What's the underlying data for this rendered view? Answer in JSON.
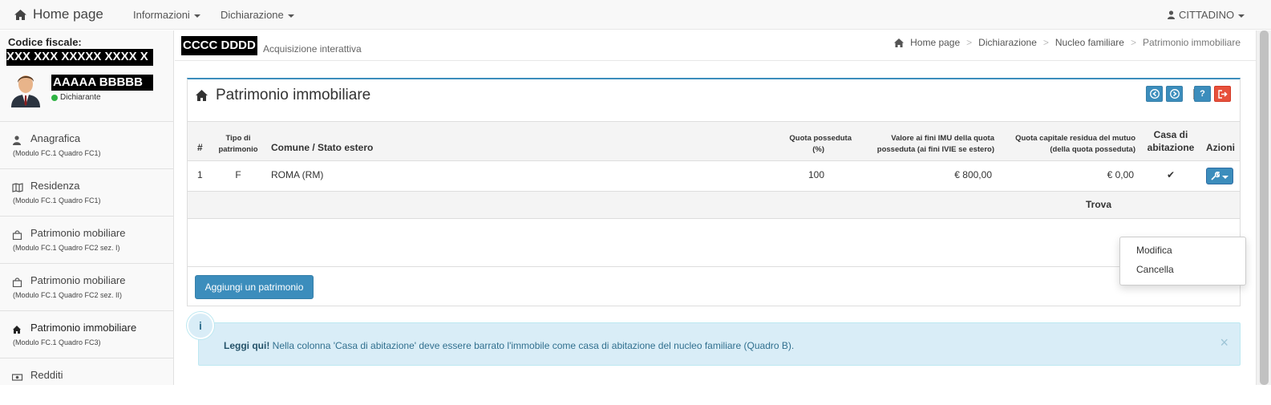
{
  "navbar": {
    "brand": "Home page",
    "menu_informazioni": "Informazioni",
    "menu_dichiarazione": "Dichiarazione",
    "user_menu": "CITTADINO"
  },
  "sidebar": {
    "cf_label": "Codice fiscale:",
    "cf_value": "XXX XXX XXXXX XXXX X",
    "user_name": "AAAAA BBBBB",
    "user_role": "Dichiarante",
    "items": [
      {
        "label": "Anagrafica",
        "sub": "(Modulo FC.1 Quadro FC1)",
        "icon": "user-icon"
      },
      {
        "label": "Residenza",
        "sub": "(Modulo FC.1 Quadro FC1)",
        "icon": "map-icon"
      },
      {
        "label": "Patrimonio mobiliare",
        "sub": "(Modulo FC.1 Quadro FC2 sez. I)",
        "icon": "bag-icon"
      },
      {
        "label": "Patrimonio mobiliare",
        "sub": "(Modulo FC.1 Quadro FC2 sez. II)",
        "icon": "bag-icon"
      },
      {
        "label": "Patrimonio immobiliare",
        "sub": "(Modulo FC.1 Quadro FC3)",
        "icon": "home-icon"
      },
      {
        "label": "Redditi",
        "sub": "",
        "icon": "money-icon"
      }
    ]
  },
  "header": {
    "name": "CCCC DDDD",
    "subtitle": "Acquisizione interattiva",
    "breadcrumbs": [
      "Home page",
      "Dichiarazione",
      "Nucleo familiare",
      "Patrimonio immobiliare"
    ]
  },
  "box": {
    "title": "Patrimonio immobiliare",
    "columns": {
      "num": "#",
      "tipo_l1": "Tipo di",
      "tipo_l2": "patrimonio",
      "comune": "Comune / Stato estero",
      "quota_l1": "Quota posseduta",
      "quota_l2": "(%)",
      "valore_l1": "Valore ai fini IMU della quota",
      "valore_l2": "posseduta (ai fini IVIE se estero)",
      "mutuo_l1": "Quota capitale residua del mutuo",
      "mutuo_l2": "(della quota posseduta)",
      "casa_l1": "Casa di",
      "casa_l2": "abitazione",
      "azioni": "Azioni"
    },
    "rows": [
      {
        "num": "1",
        "tipo": "F",
        "comune": "ROMA (RM)",
        "quota": "100",
        "valore": "€ 800,00",
        "mutuo": "€ 0,00",
        "casa": "✔"
      }
    ],
    "found_text": "Trova",
    "add_button": "Aggiungi un patrimonio",
    "dropdown": [
      "Modifica",
      "Cancella"
    ]
  },
  "alert": {
    "bold": "Leggi qui!",
    "text": "Nella colonna 'Casa di abitazione' deve essere barrato l'immobile come casa di abitazione del nucleo familiare (Quadro B).",
    "icon_glyph": "i",
    "close": "×"
  },
  "colors": {
    "primary": "#3c8dbc",
    "danger": "#e7513c",
    "info_bg": "#d9edf7",
    "status_green": "#2fb344"
  }
}
